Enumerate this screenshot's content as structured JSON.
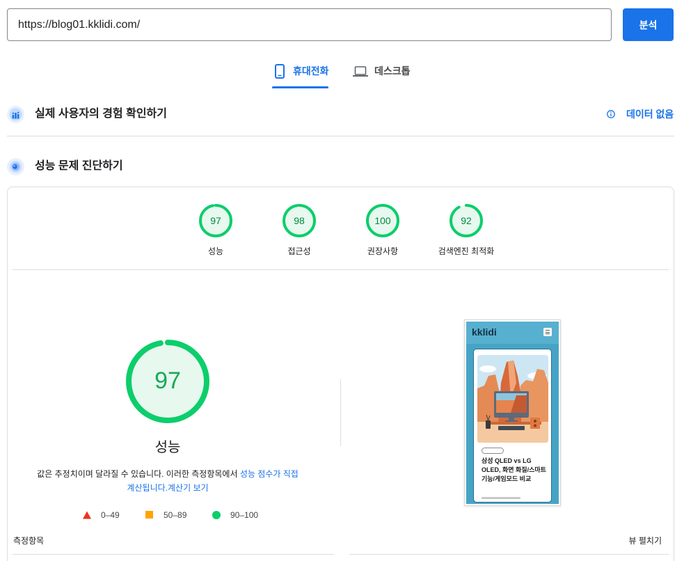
{
  "url_bar": {
    "value": "https://blog01.kklidi.com/",
    "analyze_button": "분석"
  },
  "tabs": [
    {
      "label": "휴대전화",
      "icon": "phone-icon",
      "active": true
    },
    {
      "label": "데스크톱",
      "icon": "laptop-icon",
      "active": false
    }
  ],
  "field_data": {
    "title": "실제 사용자의 경험 확인하기",
    "status": "데이터 없음",
    "icon": "crux-icon",
    "status_icon": "info-icon"
  },
  "lab_data": {
    "title": "성능 문제 진단하기",
    "icon": "lighthouse-icon"
  },
  "categories": [
    {
      "label": "성능",
      "score": 97
    },
    {
      "label": "접근성",
      "score": 98
    },
    {
      "label": "권장사항",
      "score": 100
    },
    {
      "label": "검색엔진 최적화",
      "score": 92
    }
  ],
  "performance": {
    "score": 97,
    "label": "성능",
    "note": "값은 추정치이며 달라질 수 있습니다. 이러한 측정항목에서 ",
    "score_link": "성능 점수가 직접 계산됩니다.",
    "calculator_link": "계산기 보기"
  },
  "legend": [
    {
      "range": "0–49",
      "shape": "triangle",
      "color": "#eb3223"
    },
    {
      "range": "50–89",
      "shape": "square",
      "color": "#ffa400"
    },
    {
      "range": "90–100",
      "shape": "circle",
      "color": "#0cce6b"
    }
  ],
  "final_screenshot": {
    "site_name": "kklidi",
    "post_title": "삼성 QLED vs LG OLED, 화면 화질/스마트 기능/게임모드 비교",
    "menu_icon": "hamburger-icon"
  },
  "metrics": {
    "heading": "측정항목",
    "expand_button": "뷰 펼치기"
  },
  "colors": {
    "accent": "#1a73e8",
    "pass": "#0cce6b",
    "pass_fill": "#e7f8ef",
    "pass_text": "#008a3e",
    "text": "#202124",
    "divider": "#dadce0"
  }
}
